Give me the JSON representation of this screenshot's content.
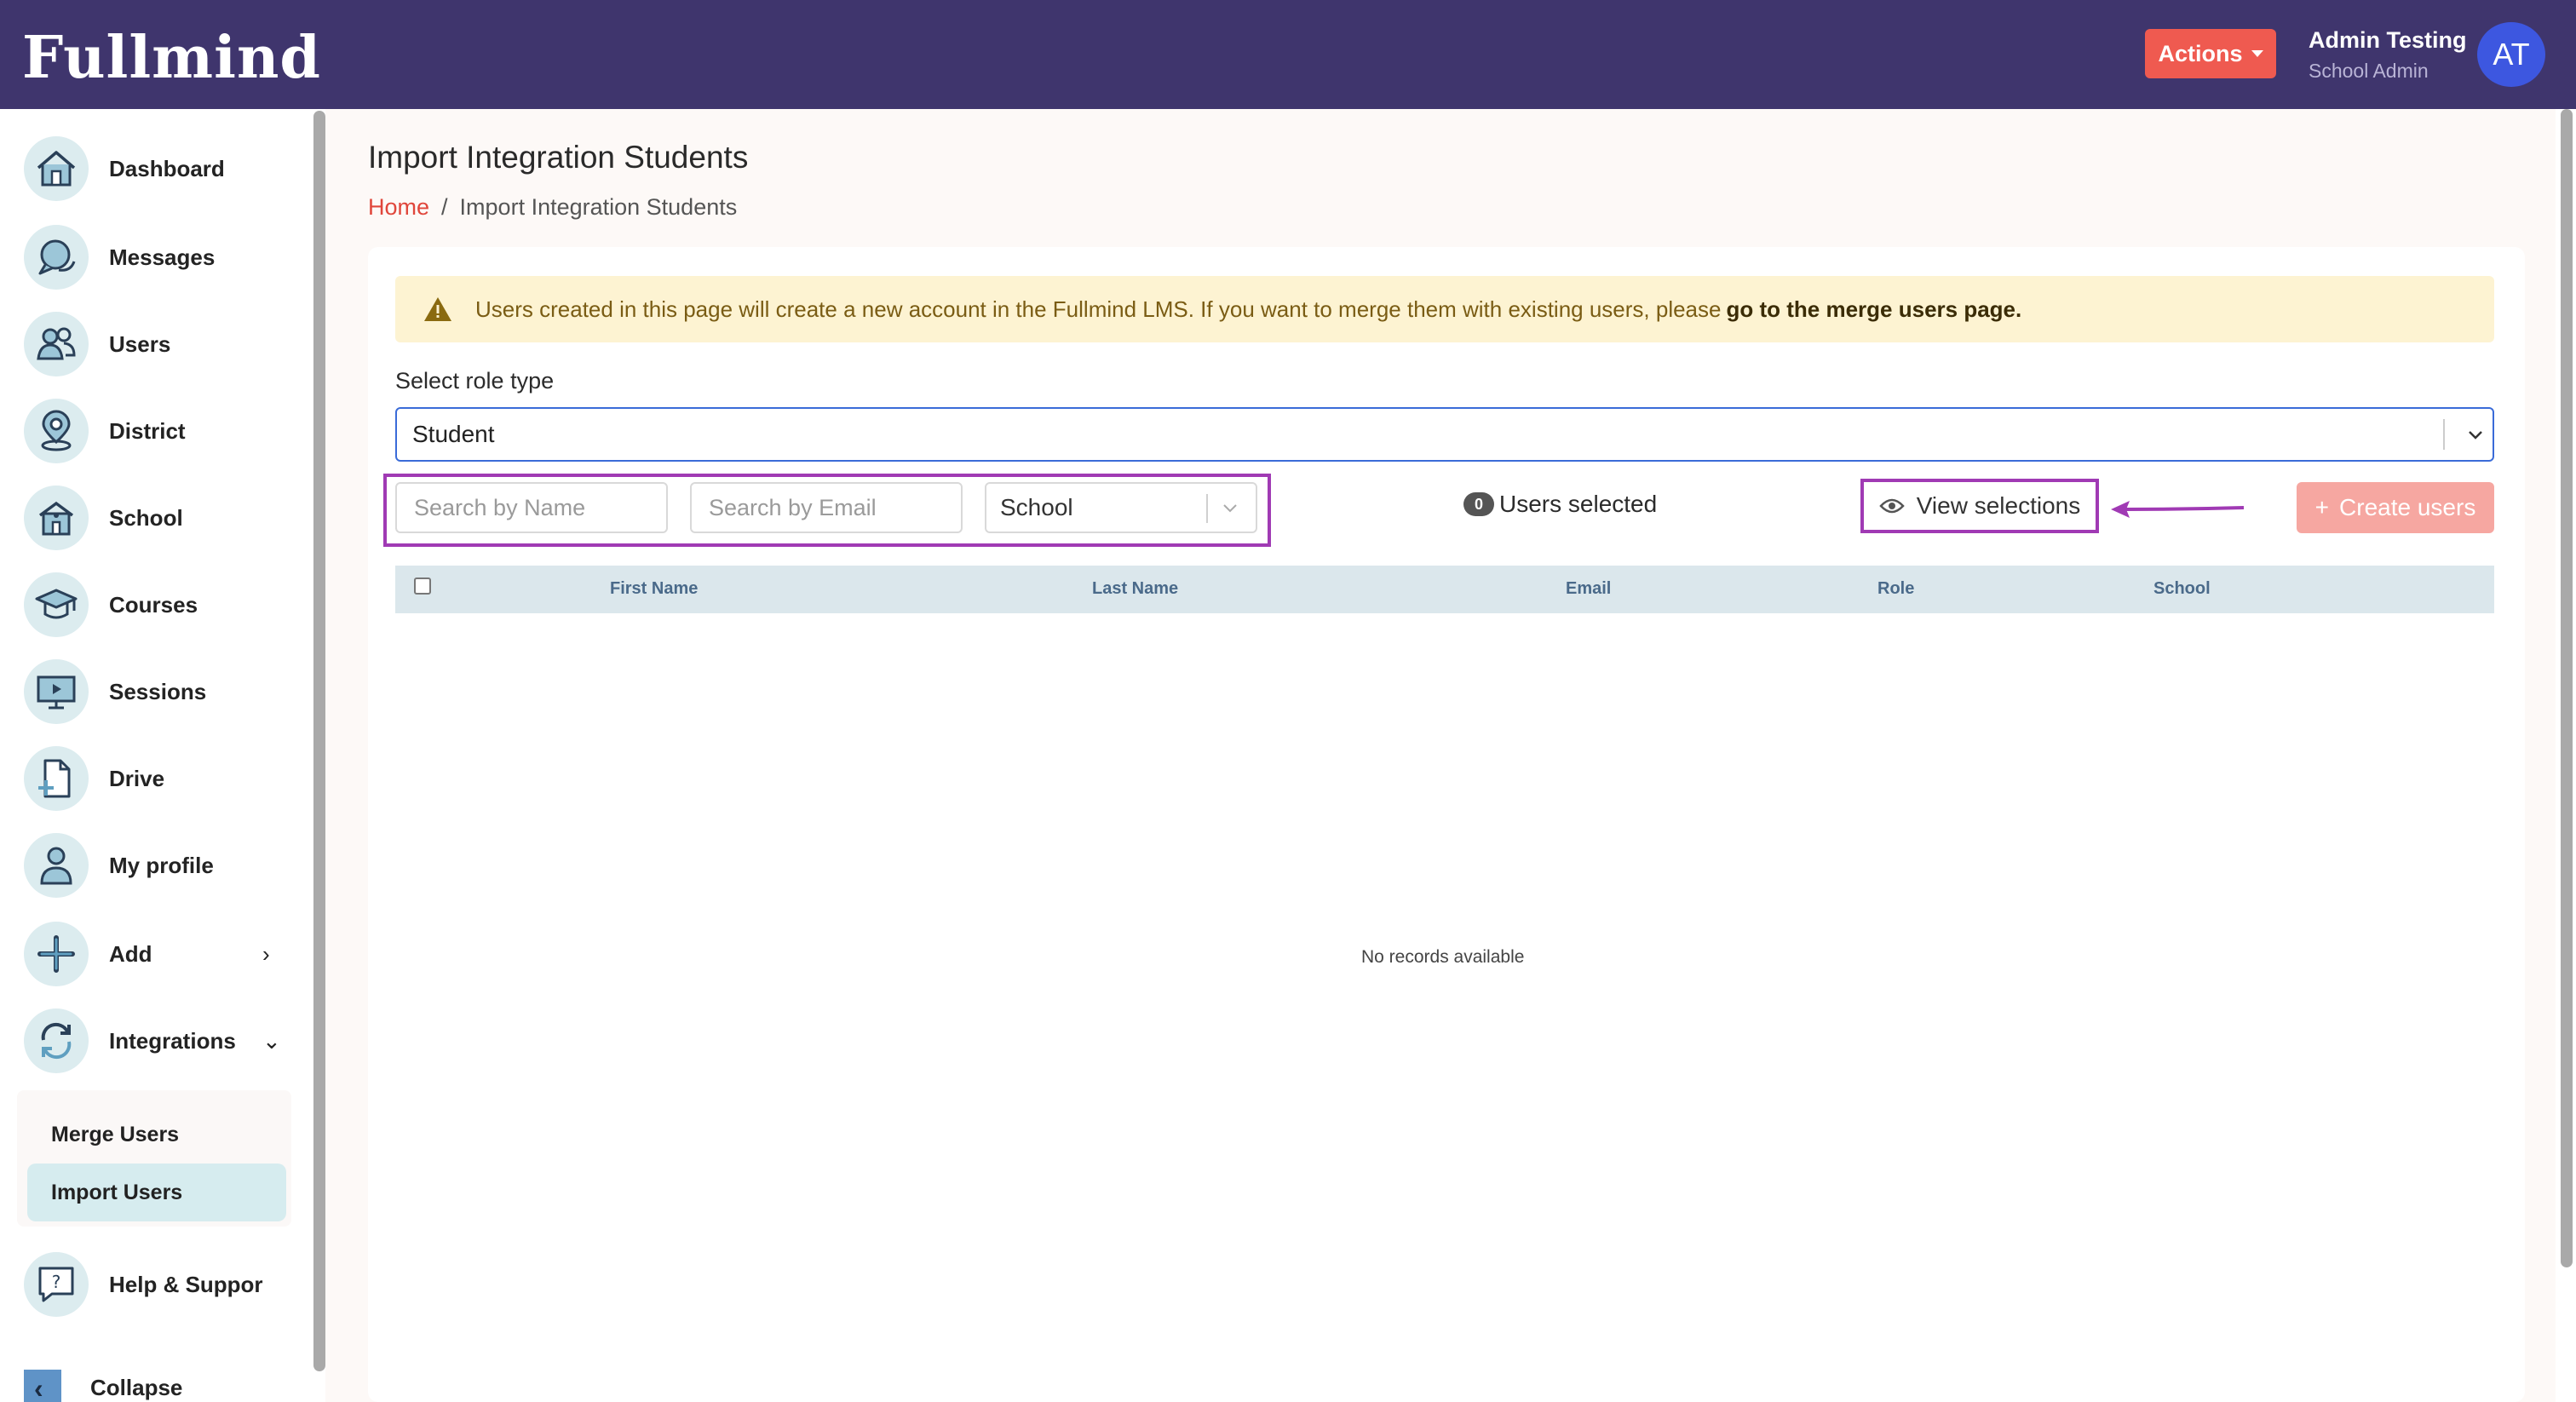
{
  "header": {
    "logo": "Fullmind",
    "actions_label": "Actions",
    "user_name": "Admin Testing",
    "user_role": "School Admin",
    "avatar_initials": "AT"
  },
  "sidebar": {
    "items": [
      {
        "label": "Dashboard",
        "icon": "home-icon"
      },
      {
        "label": "Messages",
        "icon": "messages-icon"
      },
      {
        "label": "Users",
        "icon": "users-icon"
      },
      {
        "label": "District",
        "icon": "location-pin-icon"
      },
      {
        "label": "School",
        "icon": "school-icon"
      },
      {
        "label": "Courses",
        "icon": "graduation-cap-icon"
      },
      {
        "label": "Sessions",
        "icon": "monitor-play-icon"
      },
      {
        "label": "Drive",
        "icon": "file-add-icon"
      },
      {
        "label": "My profile",
        "icon": "person-icon"
      },
      {
        "label": "Add",
        "icon": "plus-icon"
      },
      {
        "label": "Integrations",
        "icon": "sync-icon"
      }
    ],
    "subitems": [
      {
        "label": "Merge Users"
      },
      {
        "label": "Import Users",
        "active": true
      }
    ],
    "help_label": "Help & Suppor",
    "collapse_label": "Collapse"
  },
  "page": {
    "title": "Import Integration Students",
    "breadcrumb_home": "Home",
    "breadcrumb_sep": "/",
    "breadcrumb_current": "Import Integration Students"
  },
  "alert": {
    "text": "Users created in this page will create a new account in the Fullmind LMS. If you want to merge them with existing users, please",
    "link": "go to the merge users page."
  },
  "role": {
    "label": "Select role type",
    "value": "Student"
  },
  "filters": {
    "name_placeholder": "Search by Name",
    "email_placeholder": "Search by Email",
    "school_value": "School"
  },
  "selection": {
    "count": "0",
    "label": "Users selected",
    "view_label": "View selections"
  },
  "create_label": "Create users",
  "table": {
    "columns": [
      "First Name",
      "Last Name",
      "Email",
      "Role",
      "School"
    ],
    "empty": "No records available"
  },
  "colors": {
    "header_bg": "#3f356d",
    "accent": "#ef5a50",
    "highlight_box": "#a03ab4",
    "avatar": "#3d57e0"
  }
}
